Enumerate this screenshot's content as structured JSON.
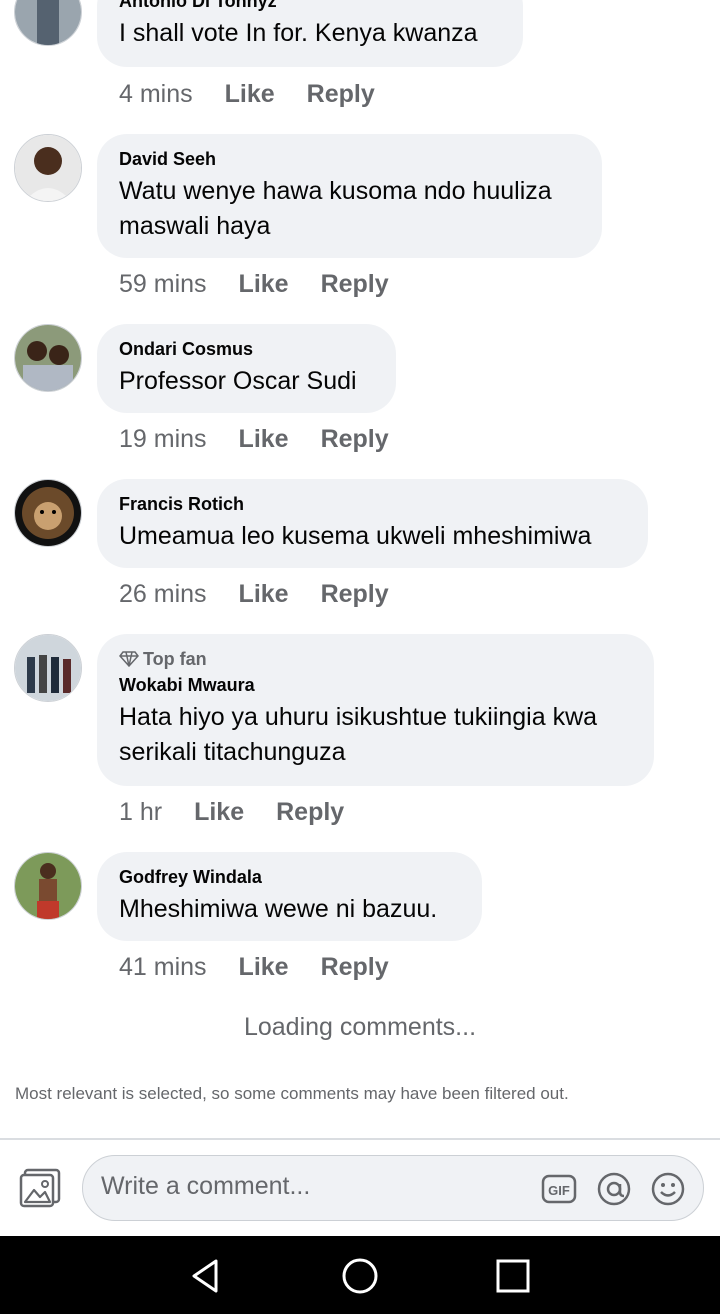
{
  "comments": [
    {
      "author": "Antonio Di Tonnyz",
      "text": "I shall vote In for. Kenya kwanza",
      "time": "4 mins",
      "like": "Like",
      "reply": "Reply"
    },
    {
      "author": "David Seeh",
      "text": "Watu wenye hawa kusoma ndo huuliza maswali haya",
      "time": "59 mins",
      "like": "Like",
      "reply": "Reply"
    },
    {
      "author": "Ondari Cosmus",
      "text": "Professor Oscar Sudi",
      "time": "19 mins",
      "like": "Like",
      "reply": "Reply"
    },
    {
      "author": "Francis Rotich",
      "text": "Umeamua leo kusema ukweli mheshimiwa",
      "time": "26 mins",
      "like": "Like",
      "reply": "Reply"
    },
    {
      "badge": "Top fan",
      "author": "Wokabi Mwaura",
      "text": "Hata hiyo ya uhuru isikushtue tukiingia kwa serikali titachunguza",
      "time": "1 hr",
      "like": "Like",
      "reply": "Reply"
    },
    {
      "author": "Godfrey Windala",
      "text": "Mheshimiwa wewe ni bazuu.",
      "time": "41 mins",
      "like": "Like",
      "reply": "Reply"
    }
  ],
  "loading_text": "Loading comments...",
  "filter_note": "Most relevant is selected, so some comments may have been filtered out.",
  "composer": {
    "placeholder": "Write a comment..."
  },
  "colors": {
    "bubble": "#f0f2f5",
    "secondary_text": "#65676b",
    "navbar": "#000000"
  },
  "icons": [
    "photo-icon",
    "gif-icon",
    "mention-icon",
    "emoji-icon",
    "back-icon",
    "home-icon",
    "recents-icon",
    "diamond-icon"
  ]
}
